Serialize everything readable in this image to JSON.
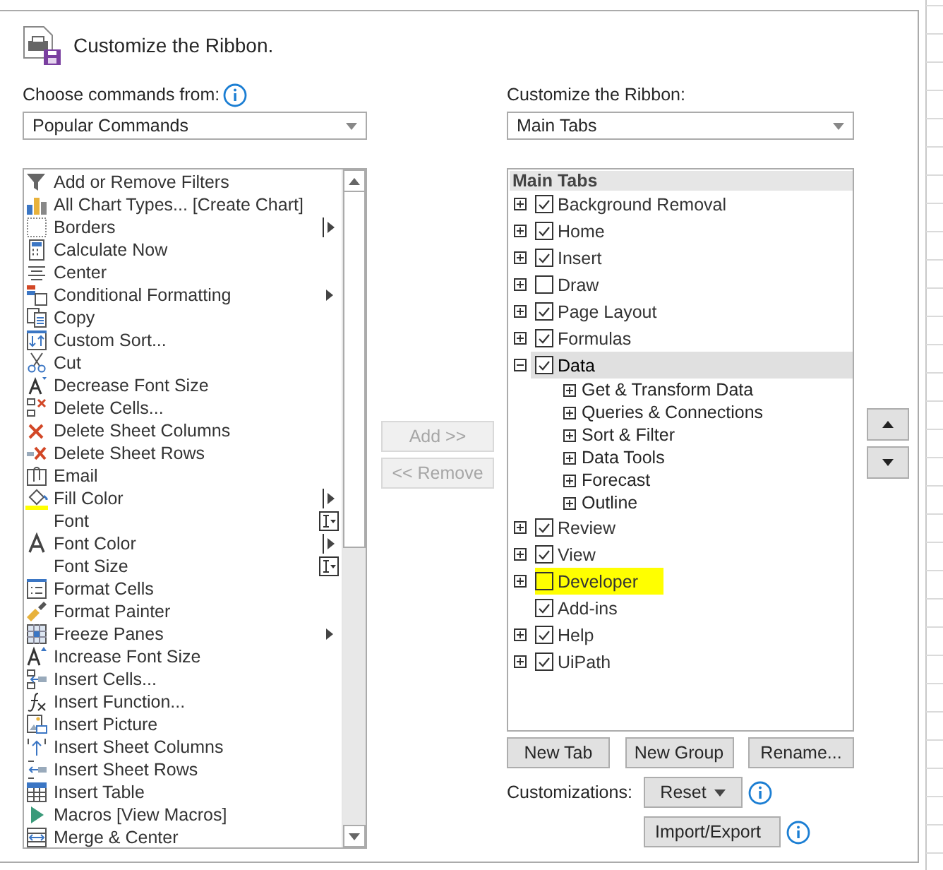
{
  "header": {
    "title": "Customize the Ribbon."
  },
  "commands_panel": {
    "label": "Choose commands from:",
    "dropdown": "Popular Commands",
    "items": [
      {
        "label": "Add or Remove Filters",
        "kind": "plain"
      },
      {
        "label": "All Chart Types... [Create Chart]",
        "kind": "plain"
      },
      {
        "label": "Borders",
        "kind": "split"
      },
      {
        "label": "Calculate Now",
        "kind": "plain"
      },
      {
        "label": "Center",
        "kind": "plain"
      },
      {
        "label": "Conditional Formatting",
        "kind": "menu"
      },
      {
        "label": "Copy",
        "kind": "plain"
      },
      {
        "label": "Custom Sort...",
        "kind": "plain"
      },
      {
        "label": "Cut",
        "kind": "plain"
      },
      {
        "label": "Decrease Font Size",
        "kind": "plain"
      },
      {
        "label": "Delete Cells...",
        "kind": "plain"
      },
      {
        "label": "Delete Sheet Columns",
        "kind": "plain"
      },
      {
        "label": "Delete Sheet Rows",
        "kind": "plain"
      },
      {
        "label": "Email",
        "kind": "plain"
      },
      {
        "label": "Fill Color",
        "kind": "split"
      },
      {
        "label": "Font",
        "kind": "combo"
      },
      {
        "label": "Font Color",
        "kind": "split"
      },
      {
        "label": "Font Size",
        "kind": "combo"
      },
      {
        "label": "Format Cells",
        "kind": "plain"
      },
      {
        "label": "Format Painter",
        "kind": "plain"
      },
      {
        "label": "Freeze Panes",
        "kind": "menu"
      },
      {
        "label": "Increase Font Size",
        "kind": "plain"
      },
      {
        "label": "Insert Cells...",
        "kind": "plain"
      },
      {
        "label": "Insert Function...",
        "kind": "plain"
      },
      {
        "label": "Insert Picture",
        "kind": "plain"
      },
      {
        "label": "Insert Sheet Columns",
        "kind": "plain"
      },
      {
        "label": "Insert Sheet Rows",
        "kind": "plain"
      },
      {
        "label": "Insert Table",
        "kind": "plain"
      },
      {
        "label": "Macros [View Macros]",
        "kind": "plain"
      },
      {
        "label": "Merge & Center",
        "kind": "plain"
      }
    ]
  },
  "transfer_buttons": [
    {
      "label": "Add >>",
      "disabled": true
    },
    {
      "label": "<< Remove",
      "disabled": true
    }
  ],
  "ribbon_panel": {
    "label": "Customize the Ribbon:",
    "dropdown": "Main Tabs",
    "tree_header": "Main Tabs",
    "tabs": [
      {
        "label": "Background Removal",
        "checked": true,
        "expandable": true,
        "selected": false,
        "highlighted": false
      },
      {
        "label": "Home",
        "checked": true,
        "expandable": true,
        "selected": false,
        "highlighted": false
      },
      {
        "label": "Insert",
        "checked": true,
        "expandable": true,
        "selected": false,
        "highlighted": false
      },
      {
        "label": "Draw",
        "checked": false,
        "expandable": true,
        "selected": false,
        "highlighted": false
      },
      {
        "label": "Page Layout",
        "checked": true,
        "expandable": true,
        "selected": false,
        "highlighted": false
      },
      {
        "label": "Formulas",
        "checked": true,
        "expandable": true,
        "selected": false,
        "highlighted": false
      },
      {
        "label": "Data",
        "checked": true,
        "expandable": true,
        "selected": true,
        "highlighted": false,
        "children": [
          {
            "label": "Get & Transform Data"
          },
          {
            "label": "Queries & Connections"
          },
          {
            "label": "Sort & Filter"
          },
          {
            "label": "Data Tools"
          },
          {
            "label": "Forecast"
          },
          {
            "label": "Outline"
          }
        ]
      },
      {
        "label": "Review",
        "checked": true,
        "expandable": true,
        "selected": false,
        "highlighted": false
      },
      {
        "label": "View",
        "checked": true,
        "expandable": true,
        "selected": false,
        "highlighted": false
      },
      {
        "label": "Developer",
        "checked": false,
        "expandable": true,
        "selected": false,
        "highlighted": true
      },
      {
        "label": "Add-ins",
        "checked": true,
        "expandable": false,
        "selected": false,
        "highlighted": false
      },
      {
        "label": "Help",
        "checked": true,
        "expandable": true,
        "selected": false,
        "highlighted": false
      },
      {
        "label": "UiPath",
        "checked": true,
        "expandable": true,
        "selected": false,
        "highlighted": false
      }
    ],
    "buttons": [
      {
        "label": "New Tab"
      },
      {
        "label": "New Group"
      },
      {
        "label": "Rename..."
      }
    ],
    "customizations_label": "Customizations:",
    "reset_button": {
      "label": "Reset"
    },
    "import_export_button": {
      "label": "Import/Export"
    }
  }
}
